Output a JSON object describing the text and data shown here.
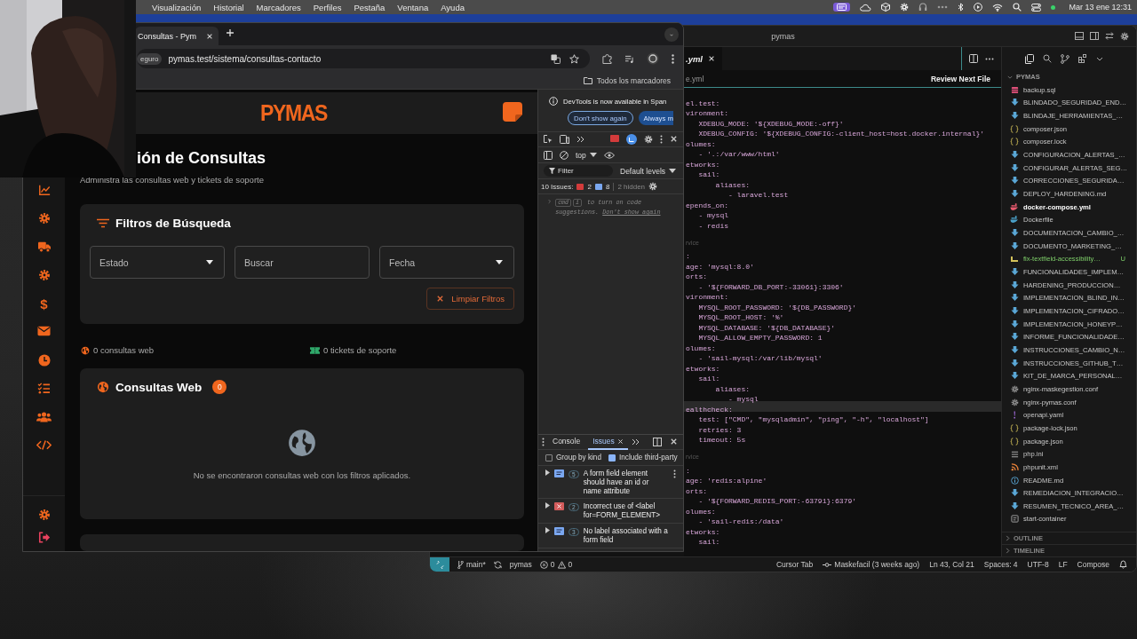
{
  "menu_bar": {
    "items": [
      "Visualización",
      "Historial",
      "Marcadores",
      "Perfiles",
      "Pestaña",
      "Ventana",
      "Ayuda"
    ],
    "clock": "Mar 13 ene 12:31"
  },
  "browser": {
    "tabs": [
      {
        "title": "Consultas - Pym",
        "selected": true
      }
    ],
    "address": {
      "security_chip": "eguro",
      "url": "pymas.test/sistema/consultas-contacto"
    },
    "bookmarks": {
      "all_bookmarks": "Todos los marcadores"
    },
    "page": {
      "logo": "PYMAS",
      "sidebar": {
        "items": [
          {
            "kind": "chart"
          },
          {
            "kind": "gear"
          },
          {
            "kind": "truck"
          },
          {
            "kind": "gear"
          },
          {
            "kind": "glyph",
            "glyph": "$"
          },
          {
            "kind": "mail"
          },
          {
            "kind": "clock"
          },
          {
            "kind": "tasks"
          },
          {
            "kind": "users"
          },
          {
            "kind": "code"
          }
        ],
        "footer": [
          {
            "kind": "gear"
          },
          {
            "kind": "logout"
          }
        ]
      },
      "title": "ión de Consultas",
      "subtitle": "Administra las consultas web y tickets de soporte",
      "filters": {
        "title": "Filtros de Búsqueda",
        "fields": [
          {
            "kind": "select",
            "label": "Estado"
          },
          {
            "kind": "text",
            "placeholder": "Buscar"
          },
          {
            "kind": "select",
            "label": "Fecha"
          }
        ],
        "clear_button": "Limpiar Filtros"
      },
      "counts": [
        {
          "kind": "web",
          "text": "0 consultas web"
        },
        {
          "kind": "tickets",
          "text": "0 tickets de soporte"
        }
      ],
      "web_inquiries": {
        "title": "Consultas Web",
        "badge": "0",
        "empty_message": "No se encontraron consultas web con los filtros aplicados."
      }
    },
    "devtools": {
      "banner": {
        "message": "DevTools is now available in Span",
        "buttons": [
          "Don't show again",
          "Always m"
        ]
      },
      "context": "top",
      "filter_placeholder": "Filter",
      "levels": "Default levels",
      "issues_summary": {
        "label": "10 Issues:",
        "errors": "2",
        "infos": "8",
        "hidden": "2 hidden"
      },
      "console_hint": {
        "keys": [
          "cmd",
          "i"
        ],
        "text": "to turn on code suggestions.",
        "link": "Don't show again"
      },
      "drawer": {
        "tabs": [
          {
            "label": "Console",
            "selected": false
          },
          {
            "label": "Issues",
            "selected": true
          }
        ],
        "options": [
          {
            "label": "Group by kind",
            "checked": false
          },
          {
            "label": "Include third-party",
            "checked": true
          }
        ],
        "issues": [
          {
            "kind": "info",
            "count": "5",
            "text": "A form field element should have an id or name attribute"
          },
          {
            "kind": "error",
            "count": "2",
            "text": "Incorrect use of <label for=FORM_ELEMENT>"
          },
          {
            "kind": "info",
            "count": "3",
            "text": "No label associated with a form field"
          }
        ]
      }
    }
  },
  "editor": {
    "title": "pymas",
    "tab": {
      "label": ".yml",
      "selected": true
    },
    "breadcrumb": "e.yml",
    "review_button": "Review Next File",
    "lines": [
      {
        "kind": "code",
        "text": "el.test:",
        "current": false
      },
      {
        "kind": "code",
        "text": "vironment:",
        "current": false
      },
      {
        "kind": "code",
        "text": "   XDEBUG_MODE: '${XDEBUG_MODE:-off}'",
        "current": false
      },
      {
        "kind": "code",
        "text": "   XDEBUG_CONFIG: '${XDEBUG_CONFIG:-client_host=host.docker.internal}'",
        "current": false
      },
      {
        "kind": "code",
        "text": "olumes:",
        "current": false
      },
      {
        "kind": "code",
        "text": "   - '.:/var/www/html'",
        "current": false
      },
      {
        "kind": "code",
        "text": "etworks:",
        "current": false
      },
      {
        "kind": "code",
        "text": "   sail:",
        "current": false
      },
      {
        "kind": "code",
        "text": "       aliases:",
        "current": false
      },
      {
        "kind": "code",
        "text": "          - laravel.test",
        "current": false
      },
      {
        "kind": "code",
        "text": "epends_on:",
        "current": false
      },
      {
        "kind": "code",
        "text": "   - mysql",
        "current": false
      },
      {
        "kind": "code",
        "text": "   - redis",
        "current": false
      },
      {
        "kind": "blank",
        "current": false
      },
      {
        "kind": "lens",
        "text": "rvice",
        "current": false
      },
      {
        "kind": "code",
        "text": ":",
        "current": false
      },
      {
        "kind": "code",
        "text": "age: 'mysql:8.0'",
        "current": false
      },
      {
        "kind": "code",
        "text": "orts:",
        "current": false
      },
      {
        "kind": "code",
        "text": "   - '${FORWARD_DB_PORT:-33061}:3306'",
        "current": false
      },
      {
        "kind": "code",
        "text": "vironment:",
        "current": false
      },
      {
        "kind": "code",
        "text": "   MYSQL_ROOT_PASSWORD: '${DB_PASSWORD}'",
        "current": false
      },
      {
        "kind": "code",
        "text": "   MYSQL_ROOT_HOST: '%'",
        "current": false
      },
      {
        "kind": "code",
        "text": "   MYSQL_DATABASE: '${DB_DATABASE}'",
        "current": false
      },
      {
        "kind": "code",
        "text": "   MYSQL_ALLOW_EMPTY_PASSWORD: 1",
        "current": false
      },
      {
        "kind": "code",
        "text": "olumes:",
        "current": false
      },
      {
        "kind": "code",
        "text": "   - 'sail-mysql:/var/lib/mysql'",
        "current": false
      },
      {
        "kind": "code",
        "text": "etworks:",
        "current": false
      },
      {
        "kind": "code",
        "text": "   sail:",
        "current": false
      },
      {
        "kind": "code",
        "text": "       aliases:",
        "current": false
      },
      {
        "kind": "code",
        "text": "          - mysql",
        "current": false
      },
      {
        "kind": "code",
        "text": "ealthcheck:",
        "current": true
      },
      {
        "kind": "code",
        "text": "   test: [\"CMD\", \"mysqladmin\", \"ping\", \"-h\", \"localhost\"]",
        "current": false
      },
      {
        "kind": "code",
        "text": "   retries: 3",
        "current": false
      },
      {
        "kind": "code",
        "text": "   timeout: 5s",
        "current": false
      },
      {
        "kind": "blank",
        "current": false
      },
      {
        "kind": "lens",
        "text": "rvice",
        "current": false
      },
      {
        "kind": "code",
        "text": ":",
        "current": false
      },
      {
        "kind": "code",
        "text": "age: 'redis:alpine'",
        "current": false
      },
      {
        "kind": "code",
        "text": "orts:",
        "current": false
      },
      {
        "kind": "code",
        "text": "   - '${FORWARD_REDIS_PORT:-63791}:6379'",
        "current": false
      },
      {
        "kind": "code",
        "text": "olumes:",
        "current": false
      },
      {
        "kind": "code",
        "text": "   - 'sail-redis:/data'",
        "current": false
      },
      {
        "kind": "code",
        "text": "etworks:",
        "current": false
      },
      {
        "kind": "code",
        "text": "   sail:",
        "current": false
      }
    ],
    "explorer": {
      "root": "PYMAS",
      "files": [
        {
          "name": "backup.sql",
          "kind": "sql",
          "selected": false
        },
        {
          "name": "BLINDADO_SEGURIDAD_END…",
          "kind": "md",
          "selected": false
        },
        {
          "name": "BLINDAJE_HERRAMIENTAS_…",
          "kind": "md",
          "selected": false
        },
        {
          "name": "composer.json",
          "kind": "json",
          "selected": false
        },
        {
          "name": "composer.lock",
          "kind": "json",
          "selected": false
        },
        {
          "name": "CONFIGURACION_ALERTAS_…",
          "kind": "md",
          "selected": false
        },
        {
          "name": "CONFIGURAR_ALERTAS_SEG…",
          "kind": "md",
          "selected": false
        },
        {
          "name": "CORRECCIONES_SEGURIDA…",
          "kind": "md",
          "selected": false
        },
        {
          "name": "DEPLOY_HARDENING.md",
          "kind": "md",
          "selected": false
        },
        {
          "name": "docker-compose.yml",
          "kind": "compose",
          "selected": true
        },
        {
          "name": "Dockerfile",
          "kind": "docker",
          "selected": false
        },
        {
          "name": "DOCUMENTACION_CAMBIO_…",
          "kind": "md",
          "selected": false
        },
        {
          "name": "DOCUMENTO_MARKETING_…",
          "kind": "md",
          "selected": false
        },
        {
          "name": "fix-textfield-accessibility…",
          "kind": "js",
          "selected": false,
          "git_status": "U"
        },
        {
          "name": "FUNCIONALIDADES_IMPLEM…",
          "kind": "md",
          "selected": false
        },
        {
          "name": "HARDENING_PRODUCCION…",
          "kind": "md",
          "selected": false
        },
        {
          "name": "IMPLEMENTACION_BLIND_IN…",
          "kind": "md",
          "selected": false
        },
        {
          "name": "IMPLEMENTACION_CIFRADO…",
          "kind": "md",
          "selected": false
        },
        {
          "name": "IMPLEMENTACION_HONEYP…",
          "kind": "md",
          "selected": false
        },
        {
          "name": "INFORME_FUNCIONALIDADE…",
          "kind": "md",
          "selected": false
        },
        {
          "name": "INSTRUCCIONES_CAMBIO_N…",
          "kind": "md",
          "selected": false
        },
        {
          "name": "INSTRUCCIONES_GITHUB_T…",
          "kind": "md",
          "selected": false
        },
        {
          "name": "KIT_DE_MARCA_PERSONAL…",
          "kind": "md",
          "selected": false
        },
        {
          "name": "nginx-maskegestion.conf",
          "kind": "conf",
          "selected": false
        },
        {
          "name": "nginx-pymas.conf",
          "kind": "conf",
          "selected": false
        },
        {
          "name": "openapi.yaml",
          "kind": "yaml",
          "selected": false
        },
        {
          "name": "package-lock.json",
          "kind": "json",
          "selected": false
        },
        {
          "name": "package.json",
          "kind": "json",
          "selected": false
        },
        {
          "name": "php.ini",
          "kind": "ini",
          "selected": false
        },
        {
          "name": "phpunit.xml",
          "kind": "xml",
          "selected": false
        },
        {
          "name": "README.md",
          "kind": "info",
          "selected": false
        },
        {
          "name": "REMEDIACION_INTEGRACIO…",
          "kind": "md",
          "selected": false
        },
        {
          "name": "RESUMEN_TECNICO_AREA_…",
          "kind": "md",
          "selected": false
        },
        {
          "name": "start-container",
          "kind": "shell",
          "selected": false
        }
      ],
      "sections": [
        "OUTLINE",
        "TIMELINE"
      ]
    },
    "status_bar": {
      "branch": "main*",
      "project": "pymas",
      "errors": "0",
      "warnings": "0",
      "items": [
        {
          "kind": "plain",
          "text": "Cursor Tab"
        },
        {
          "kind": "blame",
          "text": "Maskefacil (3 weeks ago)"
        },
        {
          "kind": "plain",
          "text": "Ln 43, Col 21"
        },
        {
          "kind": "plain",
          "text": "Spaces: 4"
        },
        {
          "kind": "plain",
          "text": "UTF-8"
        },
        {
          "kind": "plain",
          "text": "LF"
        },
        {
          "kind": "plain",
          "text": "Compose"
        }
      ]
    }
  }
}
